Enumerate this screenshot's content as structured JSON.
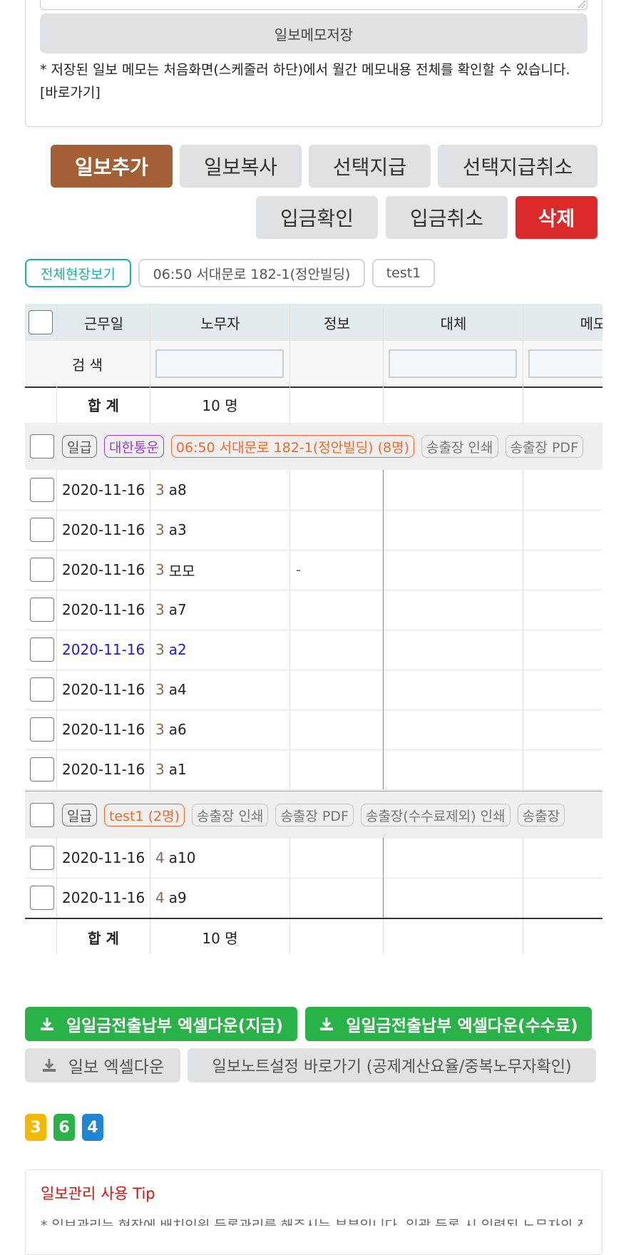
{
  "memo": {
    "save_label": "일보메모저장",
    "note": "* 저장된 일보 메모는 처음화면(스케줄러 하단)에서 월간 메모내용 전체를 확인할 수 있습니다. [바로가기]"
  },
  "actions": {
    "add": "일보추가",
    "copy": "일보복사",
    "select_pay": "선택지급",
    "select_pay_cancel": "선택지급취소",
    "deposit_confirm": "입금확인",
    "deposit_cancel": "입금취소",
    "delete": "삭제"
  },
  "filters": [
    "전체현장보기",
    "06:50 서대문로 182-1(정안빌딩)",
    "test1"
  ],
  "table": {
    "headers": {
      "date": "근무일",
      "worker": "노무자",
      "info": "정보",
      "substitute": "대체",
      "memo": "메모"
    },
    "search_label": "검 색",
    "total_label": "합 계",
    "total_value": "10 명",
    "groups": [
      {
        "tags": [
          "일급",
          "대한통운",
          "06:50 서대문로 182-1(정안빌딩) (8명)",
          "송출장 인쇄",
          "송출장 PDF"
        ],
        "rows": [
          {
            "date": "2020-11-16",
            "num": "3",
            "name": "a8",
            "info": ""
          },
          {
            "date": "2020-11-16",
            "num": "3",
            "name": "a3",
            "info": ""
          },
          {
            "date": "2020-11-16",
            "num": "3",
            "name": "모모",
            "info": "-"
          },
          {
            "date": "2020-11-16",
            "num": "3",
            "name": "a7",
            "info": ""
          },
          {
            "date": "2020-11-16",
            "num": "3",
            "name": "a2",
            "info": ""
          },
          {
            "date": "2020-11-16",
            "num": "3",
            "name": "a4",
            "info": ""
          },
          {
            "date": "2020-11-16",
            "num": "3",
            "name": "a6",
            "info": ""
          },
          {
            "date": "2020-11-16",
            "num": "3",
            "name": "a1",
            "info": ""
          }
        ]
      },
      {
        "tags": [
          "일급",
          "test1 (2명)",
          "송출장 인쇄",
          "송출장 PDF",
          "송출장(수수료제외) 인쇄",
          "송출장"
        ],
        "rows": [
          {
            "date": "2020-11-16",
            "num": "4",
            "name": "a10",
            "info": ""
          },
          {
            "date": "2020-11-16",
            "num": "4",
            "name": "a9",
            "info": ""
          }
        ]
      }
    ]
  },
  "downloads": {
    "excel_pay": "일일금전출납부 엑셀다운(지급)",
    "excel_fee": "일일금전출납부 엑셀다운(수수료)",
    "daily_excel": "일보 엑셀다운",
    "settings_link": "일보노트설정 바로가기 (공제계산요율/중복노무자확인)"
  },
  "badges": [
    {
      "label": "3",
      "color": "#f5b800"
    },
    {
      "label": "6",
      "color": "#29b247"
    },
    {
      "label": "4",
      "color": "#1f86d6"
    }
  ],
  "tip": {
    "title": "일보관리 사용 Tip",
    "line": "* 일보관리는 현장에 배치인원 등록관리를 해주시는 부분입니다. 일괄 등록 시 입력된 노무자의 정보를"
  },
  "colors": {
    "highlight_row_text": "#1a1ae6"
  }
}
